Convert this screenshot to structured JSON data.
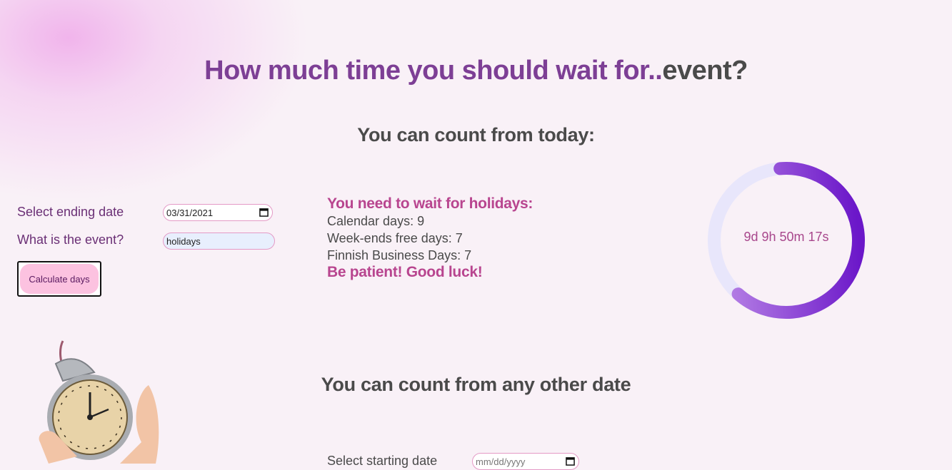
{
  "title": {
    "accent": "How much time you should wait for..",
    "rest": "event?"
  },
  "today_section": {
    "heading": "You can count from today:",
    "ending_date_label": "Select ending date",
    "ending_date_value": "03/31/2021",
    "event_label": "What is the event?",
    "event_value": "holidays",
    "button_label": "Calculate days"
  },
  "result": {
    "headline": "You need to wait for holidays:",
    "calendar_days": "Calendar days: 9",
    "weekend_free_days": "Week-ends free days: 7",
    "business_days": "Finnish Business Days: 7",
    "closing": "Be patient! Good luck!"
  },
  "countdown": {
    "text": "9d 9h 50m 17s",
    "progress_fraction": 0.63,
    "track_color": "#e8e6fb",
    "progress_color_start": "#b985e6",
    "progress_color_end": "#6b17c9"
  },
  "other_section": {
    "heading": "You can count from any other date",
    "starting_date_label": "Select starting date",
    "starting_date_placeholder": "mm/dd/yyyy"
  },
  "icons": {
    "calendar": "calendar-icon",
    "clock": "alarm-clock-icon"
  }
}
